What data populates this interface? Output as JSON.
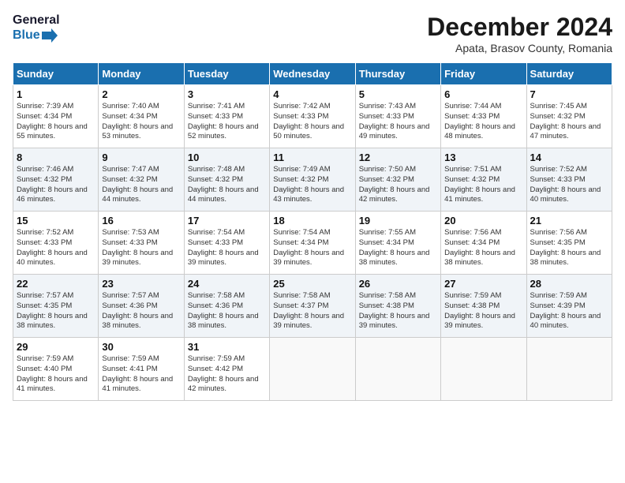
{
  "logo": {
    "line1": "General",
    "line2": "Blue"
  },
  "title": "December 2024",
  "subtitle": "Apata, Brasov County, Romania",
  "days_header": [
    "Sunday",
    "Monday",
    "Tuesday",
    "Wednesday",
    "Thursday",
    "Friday",
    "Saturday"
  ],
  "weeks": [
    [
      {
        "day": "1",
        "sunrise": "Sunrise: 7:39 AM",
        "sunset": "Sunset: 4:34 PM",
        "daylight": "Daylight: 8 hours and 55 minutes."
      },
      {
        "day": "2",
        "sunrise": "Sunrise: 7:40 AM",
        "sunset": "Sunset: 4:34 PM",
        "daylight": "Daylight: 8 hours and 53 minutes."
      },
      {
        "day": "3",
        "sunrise": "Sunrise: 7:41 AM",
        "sunset": "Sunset: 4:33 PM",
        "daylight": "Daylight: 8 hours and 52 minutes."
      },
      {
        "day": "4",
        "sunrise": "Sunrise: 7:42 AM",
        "sunset": "Sunset: 4:33 PM",
        "daylight": "Daylight: 8 hours and 50 minutes."
      },
      {
        "day": "5",
        "sunrise": "Sunrise: 7:43 AM",
        "sunset": "Sunset: 4:33 PM",
        "daylight": "Daylight: 8 hours and 49 minutes."
      },
      {
        "day": "6",
        "sunrise": "Sunrise: 7:44 AM",
        "sunset": "Sunset: 4:33 PM",
        "daylight": "Daylight: 8 hours and 48 minutes."
      },
      {
        "day": "7",
        "sunrise": "Sunrise: 7:45 AM",
        "sunset": "Sunset: 4:32 PM",
        "daylight": "Daylight: 8 hours and 47 minutes."
      }
    ],
    [
      {
        "day": "8",
        "sunrise": "Sunrise: 7:46 AM",
        "sunset": "Sunset: 4:32 PM",
        "daylight": "Daylight: 8 hours and 46 minutes."
      },
      {
        "day": "9",
        "sunrise": "Sunrise: 7:47 AM",
        "sunset": "Sunset: 4:32 PM",
        "daylight": "Daylight: 8 hours and 44 minutes."
      },
      {
        "day": "10",
        "sunrise": "Sunrise: 7:48 AM",
        "sunset": "Sunset: 4:32 PM",
        "daylight": "Daylight: 8 hours and 44 minutes."
      },
      {
        "day": "11",
        "sunrise": "Sunrise: 7:49 AM",
        "sunset": "Sunset: 4:32 PM",
        "daylight": "Daylight: 8 hours and 43 minutes."
      },
      {
        "day": "12",
        "sunrise": "Sunrise: 7:50 AM",
        "sunset": "Sunset: 4:32 PM",
        "daylight": "Daylight: 8 hours and 42 minutes."
      },
      {
        "day": "13",
        "sunrise": "Sunrise: 7:51 AM",
        "sunset": "Sunset: 4:32 PM",
        "daylight": "Daylight: 8 hours and 41 minutes."
      },
      {
        "day": "14",
        "sunrise": "Sunrise: 7:52 AM",
        "sunset": "Sunset: 4:33 PM",
        "daylight": "Daylight: 8 hours and 40 minutes."
      }
    ],
    [
      {
        "day": "15",
        "sunrise": "Sunrise: 7:52 AM",
        "sunset": "Sunset: 4:33 PM",
        "daylight": "Daylight: 8 hours and 40 minutes."
      },
      {
        "day": "16",
        "sunrise": "Sunrise: 7:53 AM",
        "sunset": "Sunset: 4:33 PM",
        "daylight": "Daylight: 8 hours and 39 minutes."
      },
      {
        "day": "17",
        "sunrise": "Sunrise: 7:54 AM",
        "sunset": "Sunset: 4:33 PM",
        "daylight": "Daylight: 8 hours and 39 minutes."
      },
      {
        "day": "18",
        "sunrise": "Sunrise: 7:54 AM",
        "sunset": "Sunset: 4:34 PM",
        "daylight": "Daylight: 8 hours and 39 minutes."
      },
      {
        "day": "19",
        "sunrise": "Sunrise: 7:55 AM",
        "sunset": "Sunset: 4:34 PM",
        "daylight": "Daylight: 8 hours and 38 minutes."
      },
      {
        "day": "20",
        "sunrise": "Sunrise: 7:56 AM",
        "sunset": "Sunset: 4:34 PM",
        "daylight": "Daylight: 8 hours and 38 minutes."
      },
      {
        "day": "21",
        "sunrise": "Sunrise: 7:56 AM",
        "sunset": "Sunset: 4:35 PM",
        "daylight": "Daylight: 8 hours and 38 minutes."
      }
    ],
    [
      {
        "day": "22",
        "sunrise": "Sunrise: 7:57 AM",
        "sunset": "Sunset: 4:35 PM",
        "daylight": "Daylight: 8 hours and 38 minutes."
      },
      {
        "day": "23",
        "sunrise": "Sunrise: 7:57 AM",
        "sunset": "Sunset: 4:36 PM",
        "daylight": "Daylight: 8 hours and 38 minutes."
      },
      {
        "day": "24",
        "sunrise": "Sunrise: 7:58 AM",
        "sunset": "Sunset: 4:36 PM",
        "daylight": "Daylight: 8 hours and 38 minutes."
      },
      {
        "day": "25",
        "sunrise": "Sunrise: 7:58 AM",
        "sunset": "Sunset: 4:37 PM",
        "daylight": "Daylight: 8 hours and 39 minutes."
      },
      {
        "day": "26",
        "sunrise": "Sunrise: 7:58 AM",
        "sunset": "Sunset: 4:38 PM",
        "daylight": "Daylight: 8 hours and 39 minutes."
      },
      {
        "day": "27",
        "sunrise": "Sunrise: 7:59 AM",
        "sunset": "Sunset: 4:38 PM",
        "daylight": "Daylight: 8 hours and 39 minutes."
      },
      {
        "day": "28",
        "sunrise": "Sunrise: 7:59 AM",
        "sunset": "Sunset: 4:39 PM",
        "daylight": "Daylight: 8 hours and 40 minutes."
      }
    ],
    [
      {
        "day": "29",
        "sunrise": "Sunrise: 7:59 AM",
        "sunset": "Sunset: 4:40 PM",
        "daylight": "Daylight: 8 hours and 41 minutes."
      },
      {
        "day": "30",
        "sunrise": "Sunrise: 7:59 AM",
        "sunset": "Sunset: 4:41 PM",
        "daylight": "Daylight: 8 hours and 41 minutes."
      },
      {
        "day": "31",
        "sunrise": "Sunrise: 7:59 AM",
        "sunset": "Sunset: 4:42 PM",
        "daylight": "Daylight: 8 hours and 42 minutes."
      },
      null,
      null,
      null,
      null
    ]
  ]
}
